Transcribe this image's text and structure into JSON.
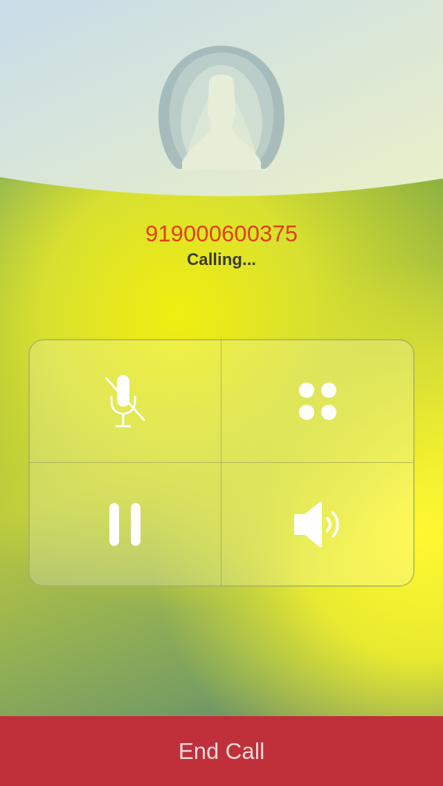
{
  "contact": {
    "number": "919000600375",
    "status": "Calling..."
  },
  "controls": [
    {
      "kind": "mute"
    },
    {
      "kind": "keypad"
    },
    {
      "kind": "hold"
    },
    {
      "kind": "speaker"
    }
  ],
  "end_button": {
    "label": "End Call"
  }
}
